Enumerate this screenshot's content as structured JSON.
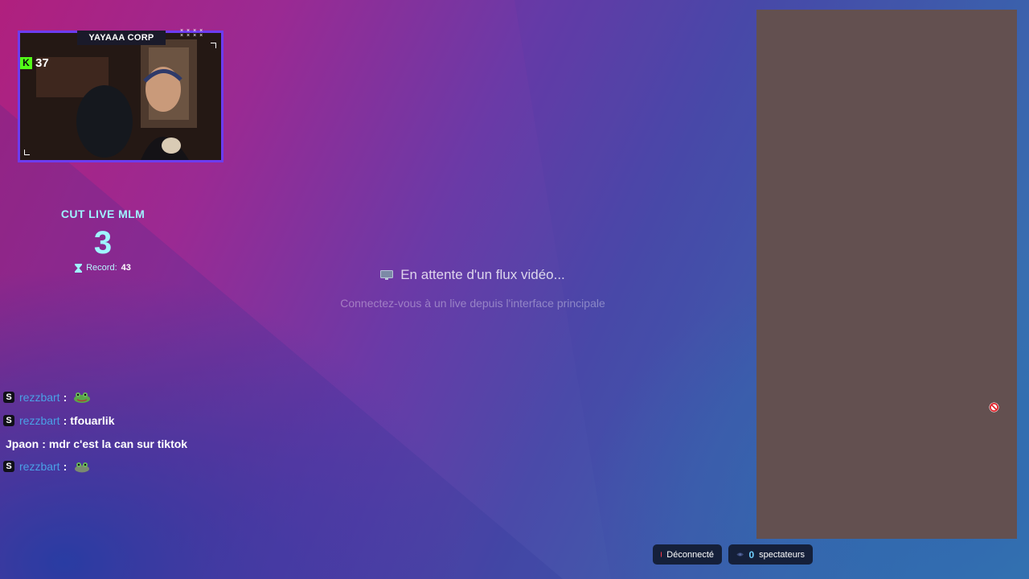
{
  "webcam": {
    "title": "YAYAAA CORP",
    "kick_count": "37",
    "kick_icon_glyph": "K",
    "frame_color": "#6c3cf0"
  },
  "counter": {
    "title": "CUT LIVE MLM",
    "value": "3",
    "record_label": "Record:",
    "record_value": "43",
    "accent": "#9ff5ff"
  },
  "stream": {
    "waiting_title": "En attente d'un flux vidéo...",
    "waiting_subtitle": "Connectez-vous à un live depuis l'interface principale"
  },
  "side_panel": {
    "background": "#635050"
  },
  "chat": {
    "separator": ":",
    "messages": [
      {
        "badge": "S",
        "user": "rezzbart",
        "text": "",
        "emote": "frog-emote"
      },
      {
        "badge": "S",
        "user": "rezzbart",
        "text": "tfouarlik",
        "emote": ""
      },
      {
        "badge": "",
        "user": "Jpaon",
        "text": "mdr c'est la can sur tiktok",
        "emote": ""
      },
      {
        "badge": "S",
        "user": "rezzbart",
        "text": "",
        "emote": "frog-emote"
      }
    ]
  },
  "status": {
    "connection_label": "Déconnecté",
    "connection_color": "#ff3b4a",
    "viewer_count": "0",
    "viewer_label": "spectateurs"
  }
}
